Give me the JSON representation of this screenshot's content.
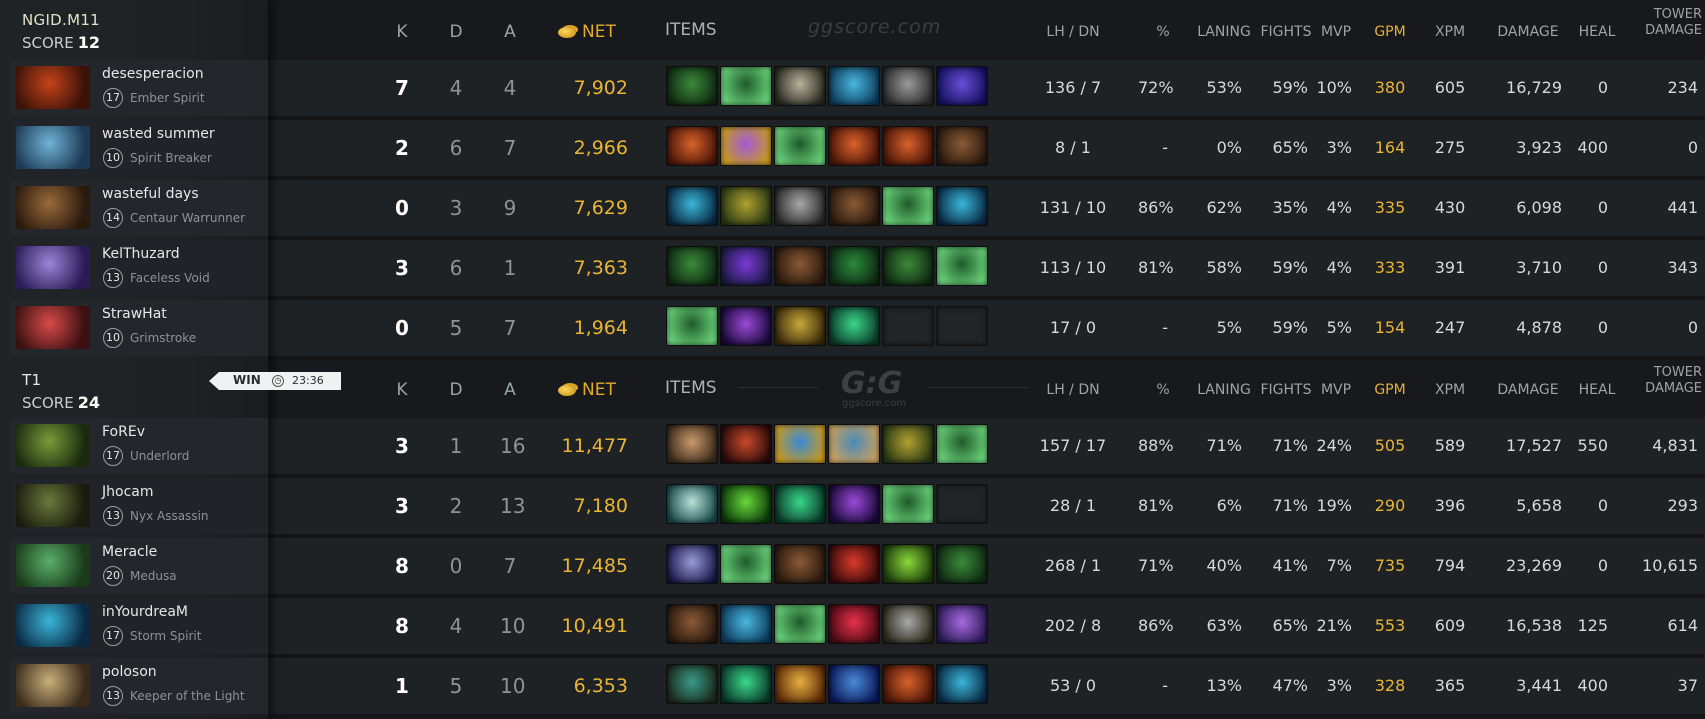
{
  "watermark": {
    "top": "ggscore.com",
    "logo": "G:G",
    "logo_sub": "ggscore.com"
  },
  "headers": {
    "k": "K",
    "d": "D",
    "a": "A",
    "net": "NET",
    "items": "ITEMS",
    "lhdn": "LH / DN",
    "pct": "%",
    "laning": "LANING",
    "fights": "FIGHTS",
    "mvp": "MVP",
    "gpm": "GPM",
    "xpm": "XPM",
    "damage": "DAMAGE",
    "heal": "HEAL",
    "tower1": "TOWER",
    "tower2": "DAMAGE"
  },
  "result": {
    "label": "WIN",
    "duration": "23:36"
  },
  "teams": [
    {
      "name": "NGID.M11",
      "score_label": "SCORE",
      "score": "12",
      "players": [
        {
          "name": "desesperacion",
          "level": "17",
          "hero": "Ember Spirit",
          "portrait": [
            "#c4431a",
            "#3a1208"
          ],
          "k": "7",
          "d": "4",
          "a": "4",
          "net": "7,902",
          "items": [
            [
              "#3b8a3a",
              "#0f2a12"
            ],
            [
              "#1f5a2a",
              "#6ad27a"
            ],
            [
              "#b9b39a",
              "#2a2a22"
            ],
            [
              "#49b7e0",
              "#0d3d5c"
            ],
            [
              "#9a9a9a",
              "#2b2b2b"
            ],
            [
              "#6a4fd6",
              "#141060"
            ]
          ],
          "lhdn": "136 / 7",
          "pct": "72%",
          "laning": "53%",
          "fights": "59%",
          "mvp": "10%",
          "gpm": "380",
          "xpm": "605",
          "damage": "16,729",
          "heal": "0",
          "tower": "234"
        },
        {
          "name": "wasted summer",
          "level": "10",
          "hero": "Spirit Breaker",
          "portrait": [
            "#6fb3d6",
            "#1d3a55"
          ],
          "k": "2",
          "d": "6",
          "a": "7",
          "net": "2,966",
          "items": [
            [
              "#d8622a",
              "#4a1508"
            ],
            [
              "#a05ad8",
              "#c89a20"
            ],
            [
              "#1f5a2a",
              "#6ad27a"
            ],
            [
              "#d8622a",
              "#4a1508"
            ],
            [
              "#d8622a",
              "#4a1508"
            ],
            [
              "#8a5a35",
              "#2a1a0e"
            ]
          ],
          "lhdn": "8 / 1",
          "pct": "-",
          "laning": "0%",
          "fights": "65%",
          "mvp": "3%",
          "gpm": "164",
          "xpm": "275",
          "damage": "3,923",
          "heal": "400",
          "tower": "0"
        },
        {
          "name": "wasteful days",
          "level": "14",
          "hero": "Centaur Warrunner",
          "portrait": [
            "#9a6a3a",
            "#2a1a0e"
          ],
          "k": "0",
          "d": "3",
          "a": "9",
          "net": "7,629",
          "items": [
            [
              "#3ab6d8",
              "#0a2a44"
            ],
            [
              "#b0a030",
              "#2a3a14"
            ],
            [
              "#a8a8a8",
              "#2a2a2a"
            ],
            [
              "#8a5a35",
              "#2a1a0e"
            ],
            [
              "#1f5a2a",
              "#6ad27a"
            ],
            [
              "#3ab6d8",
              "#0a2a44"
            ]
          ],
          "lhdn": "131 / 10",
          "pct": "86%",
          "laning": "62%",
          "fights": "35%",
          "mvp": "4%",
          "gpm": "335",
          "xpm": "430",
          "damage": "6,098",
          "heal": "0",
          "tower": "441"
        },
        {
          "name": "KelThuzard",
          "level": "13",
          "hero": "Faceless Void",
          "portrait": [
            "#9a86d8",
            "#2a1a55"
          ],
          "k": "3",
          "d": "6",
          "a": "1",
          "net": "7,363",
          "items": [
            [
              "#3b8a3a",
              "#0f2a12"
            ],
            [
              "#7a3ad8",
              "#1a1a44"
            ],
            [
              "#8a5a35",
              "#2a1a0e"
            ],
            [
              "#2a8a3a",
              "#0e2a14"
            ],
            [
              "#3b8a3a",
              "#0f2a12"
            ],
            [
              "#1f5a2a",
              "#6ad27a"
            ]
          ],
          "lhdn": "113 / 10",
          "pct": "81%",
          "laning": "58%",
          "fights": "59%",
          "mvp": "4%",
          "gpm": "333",
          "xpm": "391",
          "damage": "3,710",
          "heal": "0",
          "tower": "343"
        },
        {
          "name": "StrawHat",
          "level": "10",
          "hero": "Grimstroke",
          "portrait": [
            "#d84a4a",
            "#3a1010"
          ],
          "k": "0",
          "d": "5",
          "a": "7",
          "net": "1,964",
          "items": [
            [
              "#1f5a2a",
              "#6ad27a"
            ],
            [
              "#9a4ad8",
              "#1a0a3a"
            ],
            [
              "#c8a83a",
              "#3a2a0a"
            ],
            [
              "#3ad88a",
              "#0a3a2a"
            ],
            null,
            null
          ],
          "lhdn": "17 / 0",
          "pct": "-",
          "laning": "5%",
          "fights": "59%",
          "mvp": "5%",
          "gpm": "154",
          "xpm": "247",
          "damage": "4,878",
          "heal": "0",
          "tower": "0"
        }
      ]
    },
    {
      "name": "T1",
      "score_label": "SCORE",
      "score": "24",
      "players": [
        {
          "name": "FoREv",
          "level": "17",
          "hero": "Underlord",
          "portrait": [
            "#7a9a3a",
            "#1a2a0e"
          ],
          "k": "3",
          "d": "1",
          "a": "16",
          "net": "11,477",
          "items": [
            [
              "#c89a6a",
              "#3a2a1a"
            ],
            [
              "#c84a2a",
              "#2a0a0a"
            ],
            [
              "#3a8ad8",
              "#c89a20"
            ],
            [
              "#4a8ab8",
              "#c8a060"
            ],
            [
              "#b0a030",
              "#2a3a14"
            ],
            [
              "#1f5a2a",
              "#6ad27a"
            ]
          ],
          "lhdn": "157 / 17",
          "pct": "88%",
          "laning": "71%",
          "fights": "71%",
          "mvp": "24%",
          "gpm": "505",
          "xpm": "589",
          "damage": "17,527",
          "heal": "550",
          "tower": "4,831"
        },
        {
          "name": "Jhocam",
          "level": "13",
          "hero": "Nyx Assassin",
          "portrait": [
            "#6a7a3a",
            "#1a1a0e"
          ],
          "k": "3",
          "d": "2",
          "a": "13",
          "net": "7,180",
          "items": [
            [
              "#b8e0d8",
              "#1a4a4a"
            ],
            [
              "#6ad83a",
              "#0a3a0a"
            ],
            [
              "#3ad88a",
              "#0a3a2a"
            ],
            [
              "#9a4ad8",
              "#1a0a3a"
            ],
            [
              "#1f5a2a",
              "#6ad27a"
            ],
            null
          ],
          "lhdn": "28 / 1",
          "pct": "81%",
          "laning": "6%",
          "fights": "71%",
          "mvp": "19%",
          "gpm": "290",
          "xpm": "396",
          "damage": "5,658",
          "heal": "0",
          "tower": "293"
        },
        {
          "name": "Meracle",
          "level": "20",
          "hero": "Medusa",
          "portrait": [
            "#5ab06a",
            "#1a3a1a"
          ],
          "k": "8",
          "d": "0",
          "a": "7",
          "net": "17,485",
          "items": [
            [
              "#9a9ad8",
              "#1a1a4a"
            ],
            [
              "#1f5a2a",
              "#6ad27a"
            ],
            [
              "#8a5a35",
              "#2a1a0e"
            ],
            [
              "#d83a2a",
              "#3a0a0a"
            ],
            [
              "#8ad83a",
              "#1a3a0a"
            ],
            [
              "#3b8a3a",
              "#0f2a12"
            ]
          ],
          "lhdn": "268 / 1",
          "pct": "71%",
          "laning": "40%",
          "fights": "41%",
          "mvp": "7%",
          "gpm": "735",
          "xpm": "794",
          "damage": "23,269",
          "heal": "0",
          "tower": "10,615"
        },
        {
          "name": "inYourdreaM",
          "level": "17",
          "hero": "Storm Spirit",
          "portrait": [
            "#3ab6d8",
            "#0a2a44"
          ],
          "k": "8",
          "d": "4",
          "a": "10",
          "net": "10,491",
          "items": [
            [
              "#8a5a35",
              "#2a1a0e"
            ],
            [
              "#49b7e0",
              "#0d3d5c"
            ],
            [
              "#1f5a2a",
              "#6ad27a"
            ],
            [
              "#e8304a",
              "#4a0a14"
            ],
            [
              "#a8a8a8",
              "#2a2a1a"
            ],
            [
              "#a86ae0",
              "#2a1a55"
            ]
          ],
          "lhdn": "202 / 8",
          "pct": "86%",
          "laning": "63%",
          "fights": "65%",
          "mvp": "21%",
          "gpm": "553",
          "xpm": "609",
          "damage": "16,538",
          "heal": "125",
          "tower": "614"
        },
        {
          "name": "poloson",
          "level": "13",
          "hero": "Keeper of the Light",
          "portrait": [
            "#c8b07a",
            "#3a2a1a"
          ],
          "k": "1",
          "d": "5",
          "a": "10",
          "net": "6,353",
          "items": [
            [
              "#3a9a8a",
              "#1a2a1a"
            ],
            [
              "#3ad88a",
              "#0a3a2a"
            ],
            [
              "#e8b040",
              "#5a2a08"
            ],
            [
              "#4a8ad8",
              "#0a1a5a"
            ],
            [
              "#d8622a",
              "#4a1508"
            ],
            [
              "#3ab6d8",
              "#0a2a44"
            ]
          ],
          "lhdn": "53 / 0",
          "pct": "-",
          "laning": "13%",
          "fights": "47%",
          "mvp": "3%",
          "gpm": "328",
          "xpm": "365",
          "damage": "3,441",
          "heal": "400",
          "tower": "37"
        }
      ]
    }
  ]
}
